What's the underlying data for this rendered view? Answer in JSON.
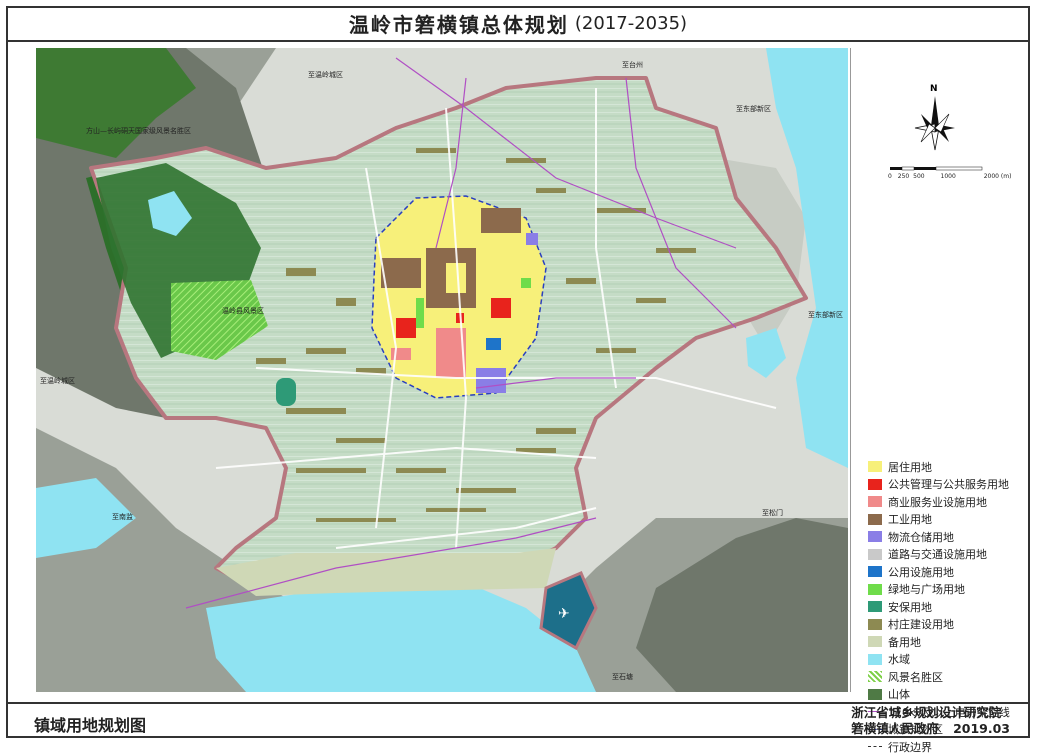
{
  "title": {
    "main": "温岭市箬横镇总体规划",
    "years": "(2017-2035)"
  },
  "footer": {
    "map_name": "镇域用地规划图",
    "institute": "浙江省城乡规划设计研究院",
    "government": "箬横镇人民政府",
    "date": "2019.03"
  },
  "compass": {
    "label": "N"
  },
  "scale": {
    "ticks": [
      "0",
      "250",
      "500",
      "1000",
      "2000"
    ],
    "unit": "(m)"
  },
  "map_labels": {
    "to_wenling_1": "至温岭城区",
    "to_taizhou": "至台州",
    "to_dongbu_1": "至东部新区",
    "to_dongbu_2": "至东部新区",
    "to_wenling_2": "至温岭城区",
    "to_songmen": "至松门",
    "to_shitang": "至石塘",
    "to_nanjian": "至南监",
    "scenic_1": "方山—长屿硐天国家级风景名胜区",
    "scenic_2": "温岭县风景区"
  },
  "legend": [
    {
      "label": "居住用地",
      "kind": "fill",
      "color": "#f7f07a"
    },
    {
      "label": "公共管理与公共服务用地",
      "kind": "fill",
      "color": "#e8231c"
    },
    {
      "label": "商业服务业设施用地",
      "kind": "fill",
      "color": "#f08a8a"
    },
    {
      "label": "工业用地",
      "kind": "fill",
      "color": "#8c6a4c"
    },
    {
      "label": "物流仓储用地",
      "kind": "fill",
      "color": "#8a7ee6"
    },
    {
      "label": "道路与交通设施用地",
      "kind": "fill",
      "color": "#c9c9c9"
    },
    {
      "label": "公用设施用地",
      "kind": "fill",
      "color": "#1e74c9"
    },
    {
      "label": "绿地与广场用地",
      "kind": "fill",
      "color": "#6fdc4a"
    },
    {
      "label": "安保用地",
      "kind": "fill",
      "color": "#2e9a77"
    },
    {
      "label": "村庄建设用地",
      "kind": "fill",
      "color": "#8d8a52"
    },
    {
      "label": "备用地",
      "kind": "fill",
      "color": "#cfd8b6"
    },
    {
      "label": "水域",
      "kind": "fill",
      "color": "#8fe3f2"
    },
    {
      "label": "风景名胜区",
      "kind": "hatch",
      "color": "#7fd04a"
    },
    {
      "label": "山体",
      "kind": "fill",
      "color": "#4f7a45"
    },
    {
      "label": "110kv及以上电力架空线",
      "kind": "line",
      "color": "#b04fc4"
    },
    {
      "label": "城镇规划区",
      "kind": "dash",
      "color": "#2a3fbf"
    },
    {
      "label": "行政边界",
      "kind": "dashdot",
      "color": "#333333"
    }
  ],
  "colors": {
    "farmland": "#c5dcc6",
    "sea": "#8fe3f2",
    "boundary": "#b7777f",
    "mountain": "#7f857c"
  }
}
